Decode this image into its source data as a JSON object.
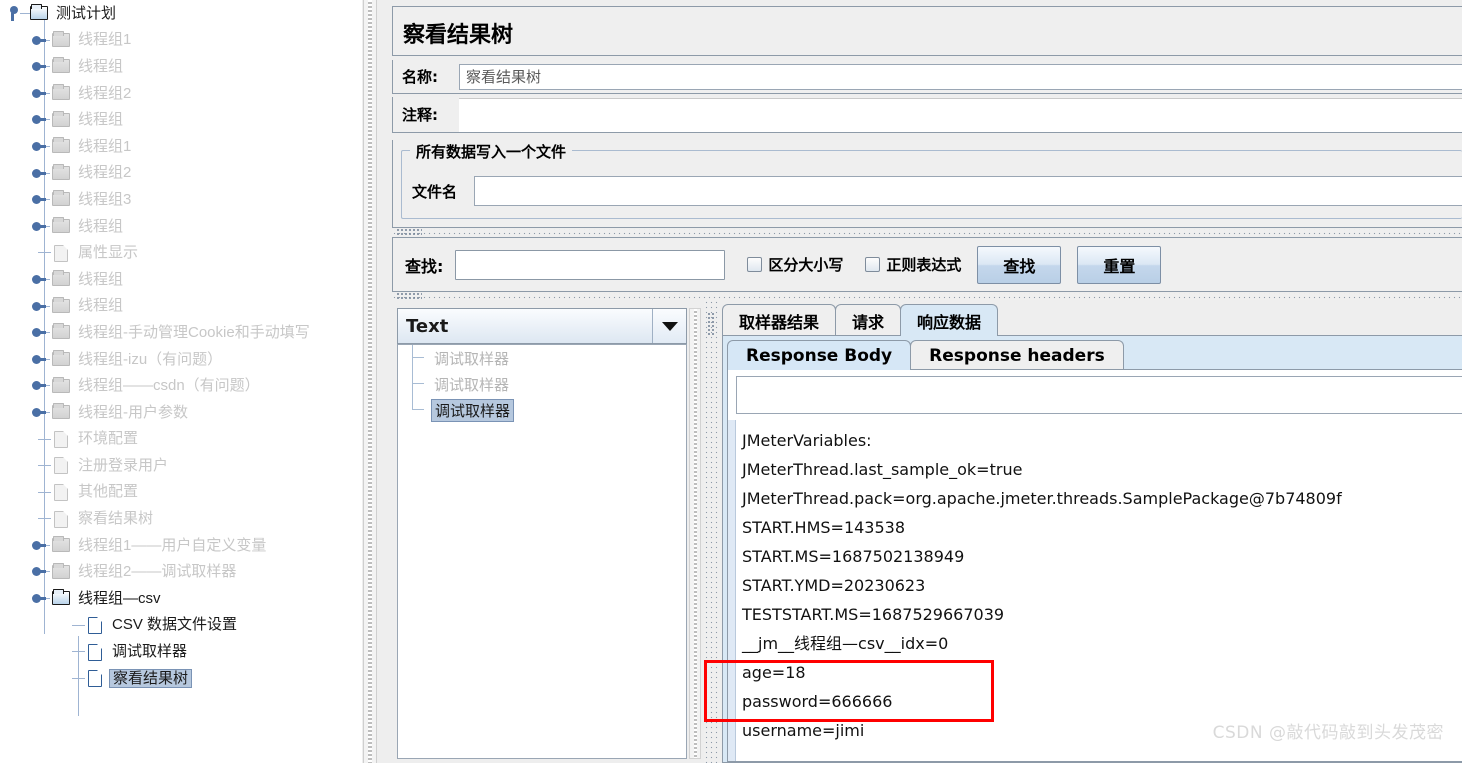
{
  "tree": {
    "root": {
      "label": "测试计划",
      "icon": "folder-icon"
    },
    "items": [
      {
        "label": "线程组1",
        "icon": "folder-icon",
        "type": "folder",
        "state": "inactive"
      },
      {
        "label": "线程组",
        "icon": "folder-icon",
        "type": "folder",
        "state": "inactive"
      },
      {
        "label": "线程组2",
        "icon": "folder-icon",
        "type": "folder",
        "state": "inactive"
      },
      {
        "label": "线程组",
        "icon": "folder-icon",
        "type": "folder",
        "state": "inactive"
      },
      {
        "label": "线程组1",
        "icon": "folder-icon",
        "type": "folder",
        "state": "inactive"
      },
      {
        "label": "线程组2",
        "icon": "folder-icon",
        "type": "folder",
        "state": "inactive"
      },
      {
        "label": "线程组3",
        "icon": "folder-icon",
        "type": "folder",
        "state": "inactive"
      },
      {
        "label": "线程组",
        "icon": "folder-icon",
        "type": "folder",
        "state": "inactive"
      },
      {
        "label": "属性显示",
        "icon": "page-icon",
        "type": "leaf",
        "state": "inactive"
      },
      {
        "label": "线程组",
        "icon": "folder-icon",
        "type": "folder",
        "state": "inactive"
      },
      {
        "label": "线程组",
        "icon": "folder-icon",
        "type": "folder",
        "state": "inactive"
      },
      {
        "label": "线程组-手动管理Cookie和手动填写",
        "icon": "folder-icon",
        "type": "folder",
        "state": "inactive"
      },
      {
        "label": "线程组-izu（有问题）",
        "icon": "folder-icon",
        "type": "folder",
        "state": "inactive"
      },
      {
        "label": "线程组——csdn（有问题）",
        "icon": "folder-icon",
        "type": "folder",
        "state": "inactive"
      },
      {
        "label": "线程组-用户参数",
        "icon": "folder-icon",
        "type": "folder",
        "state": "inactive"
      },
      {
        "label": "环境配置",
        "icon": "page-icon",
        "type": "leaf",
        "state": "inactive"
      },
      {
        "label": "注册登录用户",
        "icon": "page-icon",
        "type": "leaf",
        "state": "inactive"
      },
      {
        "label": "其他配置",
        "icon": "page-icon",
        "type": "leaf",
        "state": "inactive"
      },
      {
        "label": "察看结果树",
        "icon": "page-icon",
        "type": "leaf",
        "state": "inactive"
      },
      {
        "label": "线程组1——用户自定义变量",
        "icon": "folder-icon",
        "type": "folder",
        "state": "inactive"
      },
      {
        "label": "线程组2——调试取样器",
        "icon": "folder-icon",
        "type": "folder",
        "state": "inactive"
      },
      {
        "label": "线程组—csv",
        "icon": "folder-icon",
        "type": "folder",
        "state": "active-expanded"
      }
    ],
    "children": [
      {
        "label": "CSV 数据文件设置",
        "icon": "page-icon",
        "state": "active"
      },
      {
        "label": "调试取样器",
        "icon": "page-icon",
        "state": "active"
      },
      {
        "label": "察看结果树",
        "icon": "page-icon",
        "state": "selected"
      }
    ]
  },
  "panel": {
    "title": "察看结果树",
    "name_label": "名称:",
    "name_value": "察看结果树",
    "comment_label": "注释:",
    "comment_value": "",
    "group_legend": "所有数据写入一个文件",
    "filename_label": "文件名",
    "filename_value": ""
  },
  "search": {
    "label": "查找:",
    "value": "",
    "case_sensitive_label": "区分大小写",
    "case_sensitive_checked": false,
    "regex_label": "正则表达式",
    "regex_checked": false,
    "find_button": "查找",
    "reset_button": "重置"
  },
  "renderer": {
    "selected": "Text"
  },
  "samplers": [
    {
      "label": "调试取样器",
      "selected": false
    },
    {
      "label": "调试取样器",
      "selected": false
    },
    {
      "label": "调试取样器",
      "selected": true
    }
  ],
  "tabs": {
    "main": [
      {
        "label": "取样器结果",
        "active": false
      },
      {
        "label": "请求",
        "active": false
      },
      {
        "label": "响应数据",
        "active": true
      }
    ],
    "sub": [
      {
        "label": "Response Body",
        "active": true
      },
      {
        "label": "Response headers",
        "active": false
      }
    ]
  },
  "response": {
    "search_value": "",
    "lines": [
      "JMeterVariables:",
      "JMeterThread.last_sample_ok=true",
      "JMeterThread.pack=org.apache.jmeter.threads.SamplePackage@7b74809f",
      "START.HMS=143538",
      "START.MS=1687502138949",
      "START.YMD=20230623",
      "TESTSTART.MS=1687529667039",
      "__jm__线程组—csv__idx=0",
      "age=18",
      "password=666666",
      "username=jimi"
    ]
  },
  "annotation": {
    "highlight_color": "#ff0000",
    "highlighted_lines": [
      "age=18",
      "password=666666",
      "username=jimi"
    ]
  },
  "watermark": "CSDN @敲代码敲到头发茂密"
}
